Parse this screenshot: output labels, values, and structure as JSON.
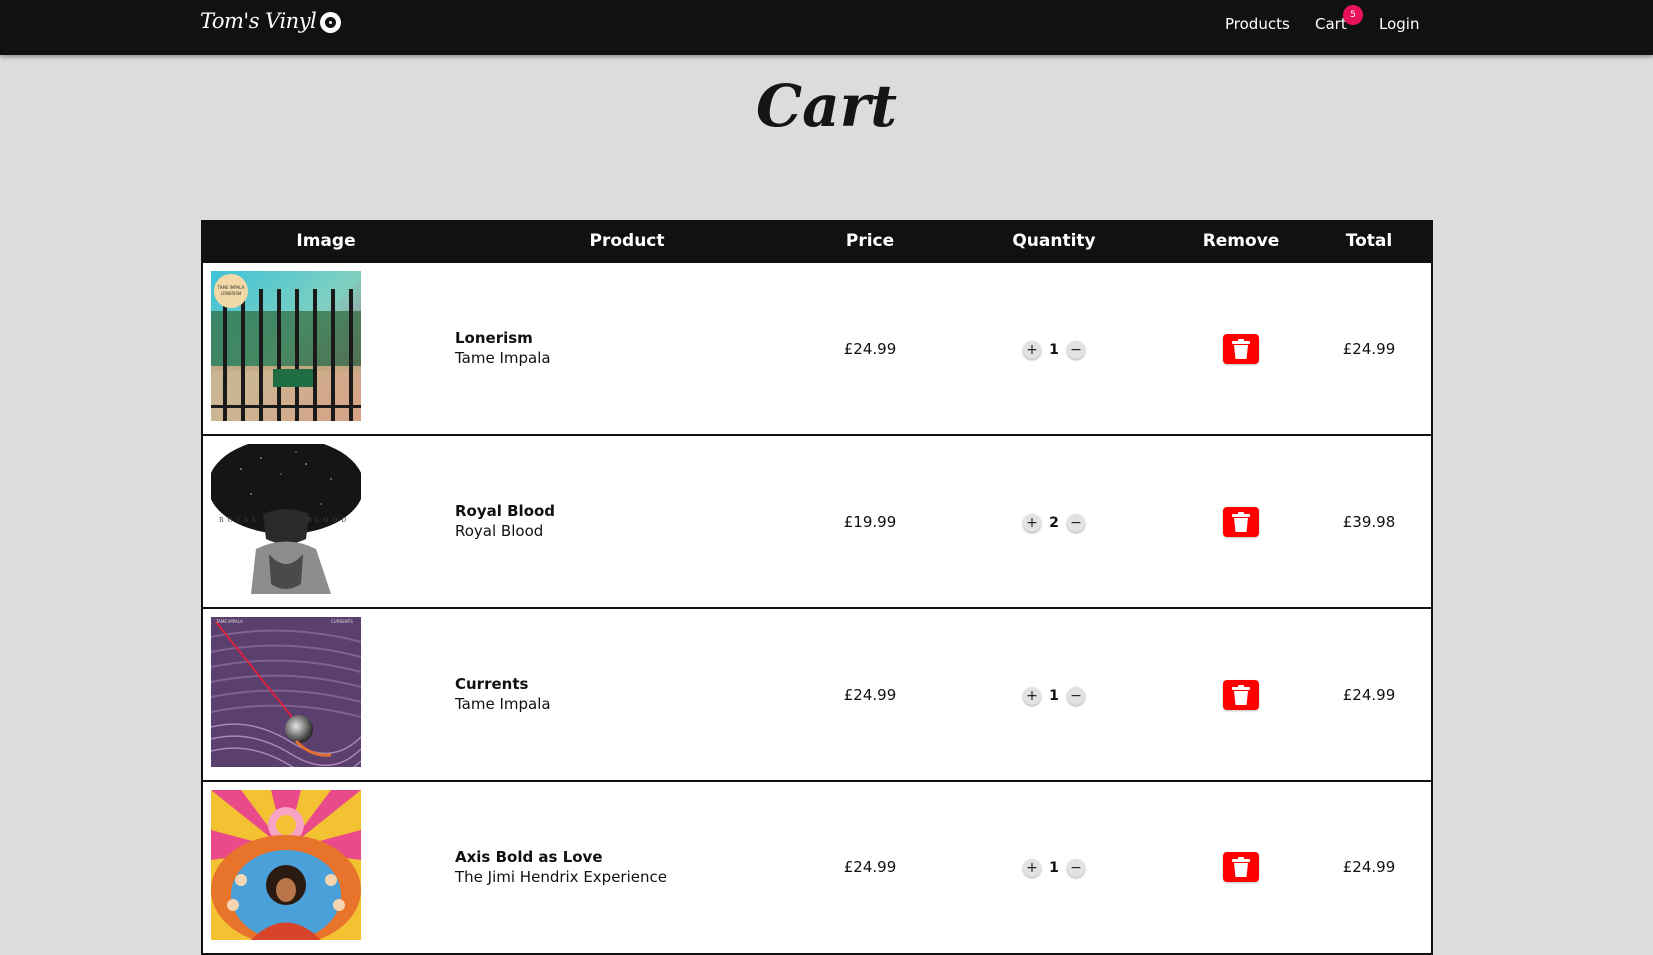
{
  "nav": {
    "brand": "Tom's Vinyl",
    "links": {
      "products": "Products",
      "cart": "Cart",
      "login": "Login"
    },
    "cart_count": "5"
  },
  "page": {
    "title": "Cart"
  },
  "table": {
    "headers": [
      "Image",
      "Product",
      "Price",
      "Quantity",
      "Remove",
      "Total"
    ],
    "rows": [
      {
        "title": "Lonerism",
        "artist": "Tame Impala",
        "price": "£24.99",
        "quantity": "1",
        "total": "£24.99",
        "cover_text": [
          "TAME IMPALA",
          "LONERISM"
        ]
      },
      {
        "title": "Royal Blood",
        "artist": "Royal Blood",
        "price": "£19.99",
        "quantity": "2",
        "total": "£39.98",
        "cover_text": [
          "ROYAL",
          "BLOOD"
        ]
      },
      {
        "title": "Currents",
        "artist": "Tame Impala",
        "price": "£24.99",
        "quantity": "1",
        "total": "£24.99",
        "cover_text": [
          "TAME IMPALA",
          "CURRENTS"
        ]
      },
      {
        "title": "Axis Bold as Love",
        "artist": "The Jimi Hendrix Experience",
        "price": "£24.99",
        "quantity": "1",
        "total": "£24.99",
        "cover_text": []
      }
    ]
  },
  "icons": {
    "plus": "plus-icon",
    "minus": "minus-icon",
    "trash": "trash-icon",
    "vinyl": "vinyl-record-icon"
  },
  "colors": {
    "nav_bg": "#111111",
    "badge": "#e8125c",
    "remove": "#ff0000",
    "page_bg": "#dcdcdc"
  }
}
